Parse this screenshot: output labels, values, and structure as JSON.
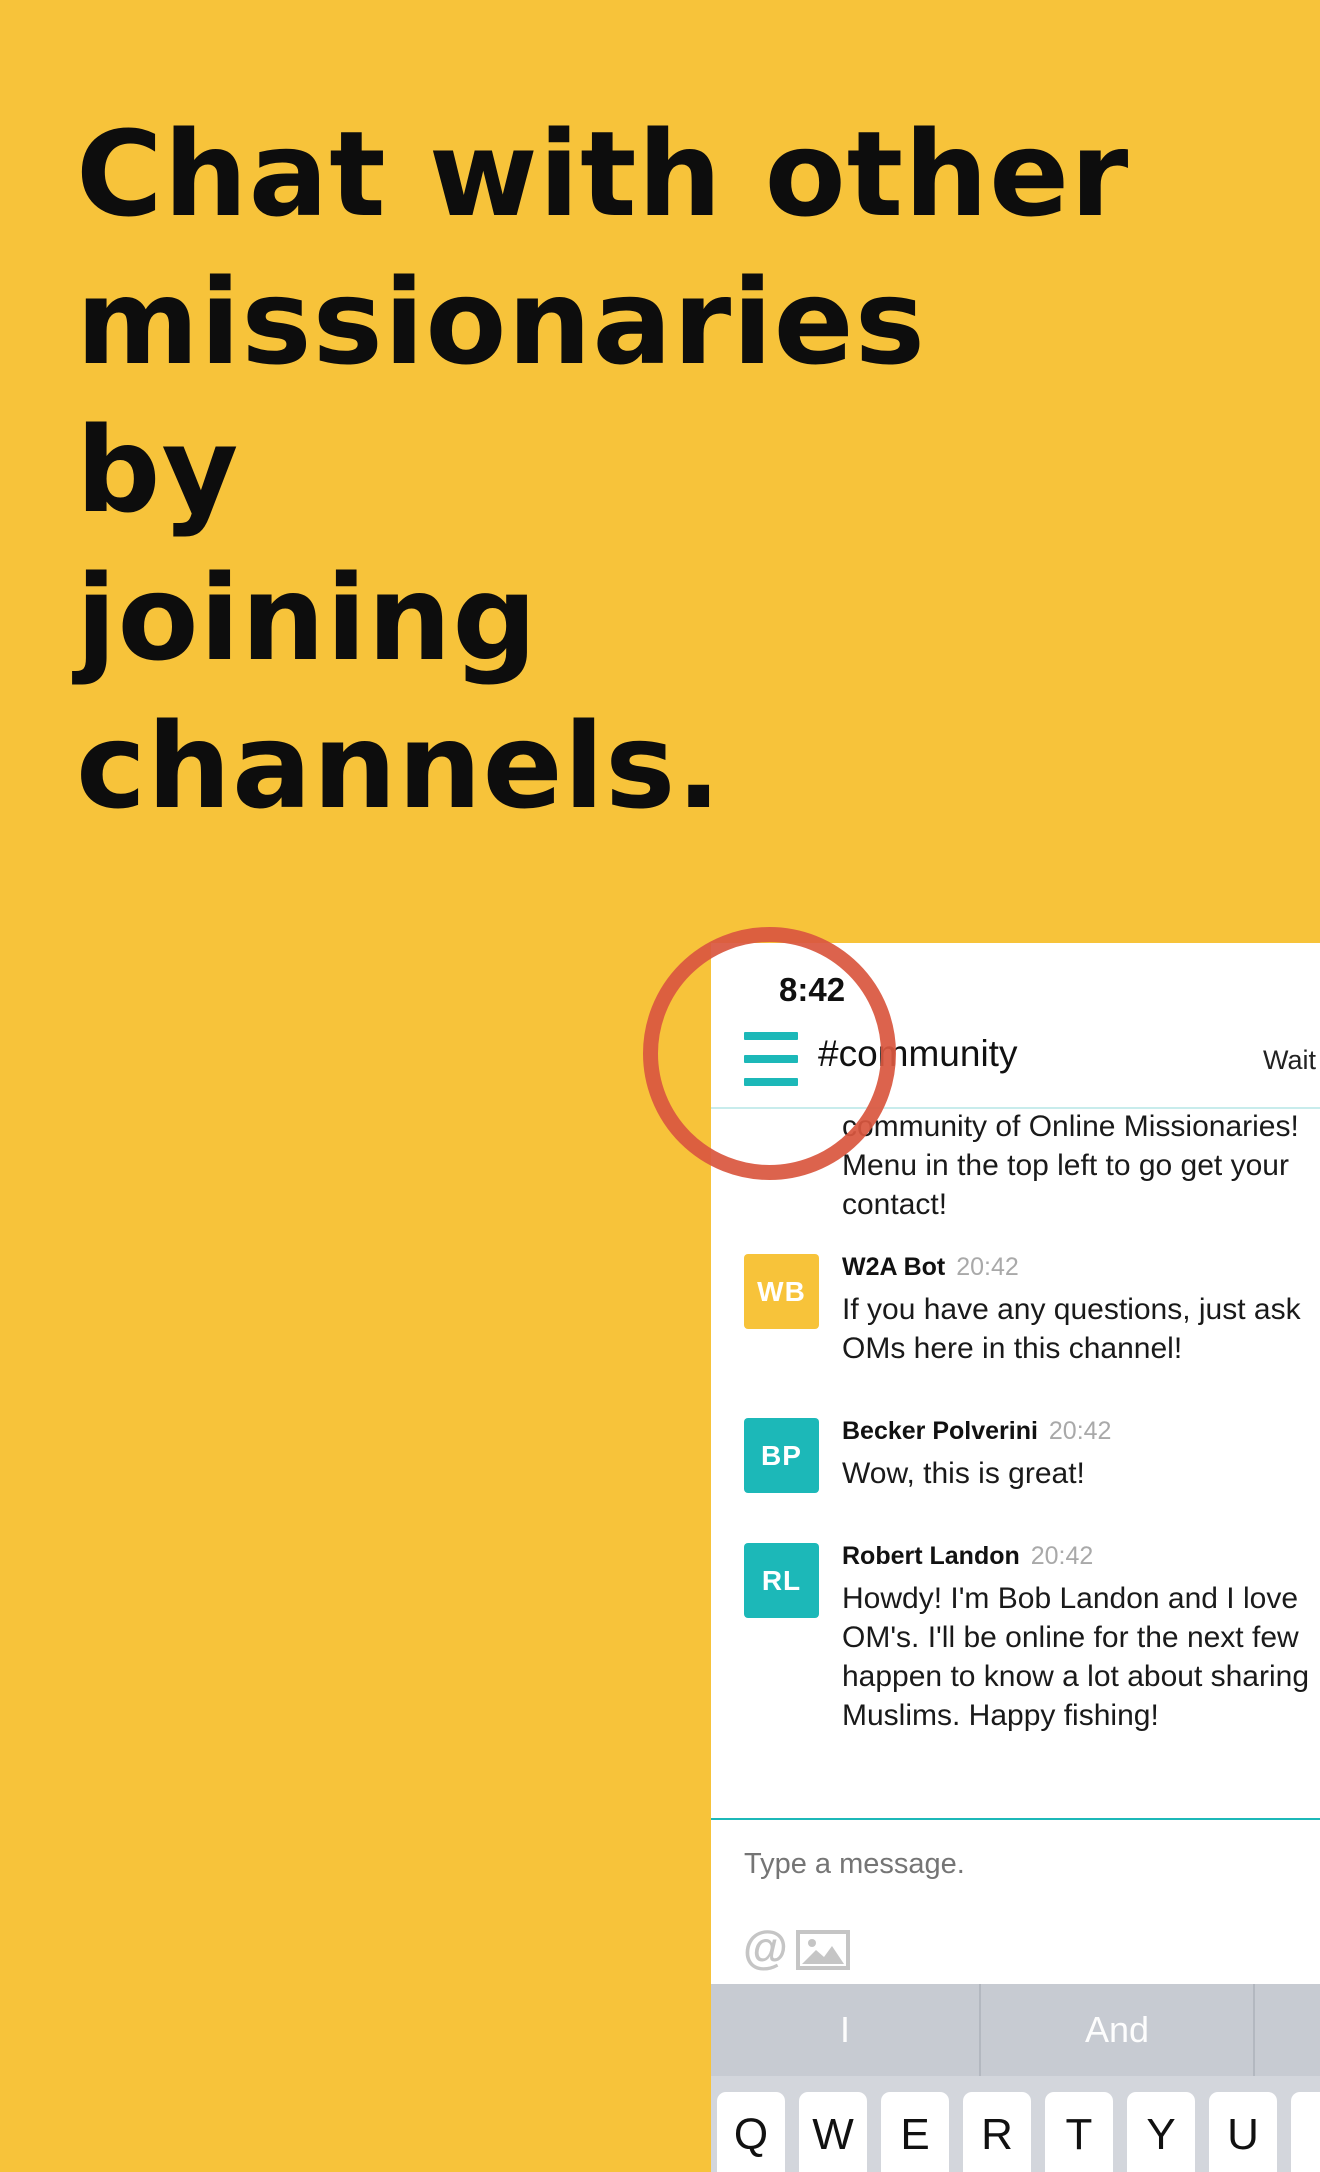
{
  "headline": [
    "Chat with other",
    "missionaries",
    "by",
    "joining",
    "channels."
  ],
  "colors": {
    "background": "#F7C33A",
    "accent": "#1CB8B8",
    "ring": "#D9573F",
    "wb_avatar": "#F7C33A",
    "teal_avatar": "#1CB8B8"
  },
  "phone": {
    "status_time": "8:42",
    "menu_icon": "hamburger-menu-icon",
    "channel_title": "#community",
    "header_right": "Wait",
    "messages_partial": [
      "community of Online Missionaries!",
      "Menu in the top left to go get your",
      "contact!"
    ],
    "messages": [
      {
        "initials": "WB",
        "author": "W2A Bot",
        "time": "20:42",
        "lines": [
          "If you have any questions, just ask",
          "OMs here in this channel!"
        ]
      },
      {
        "initials": "BP",
        "author": "Becker Polverini",
        "time": "20:42",
        "lines": [
          "Wow, this is great!"
        ]
      },
      {
        "initials": "RL",
        "author": "Robert Landon",
        "time": "20:42",
        "lines": [
          "Howdy! I'm Bob Landon and I love",
          "OM's. I'll be online for the next few",
          "happen to know a lot about sharing",
          "Muslims. Happy fishing!"
        ]
      }
    ],
    "composer": {
      "placeholder": "Type a message.",
      "mention_icon": "at-sign-icon",
      "image_icon": "image-icon"
    },
    "suggestions": [
      "I",
      "And"
    ],
    "keys": [
      "Q",
      "W",
      "E",
      "R",
      "T",
      "Y",
      "U"
    ]
  }
}
